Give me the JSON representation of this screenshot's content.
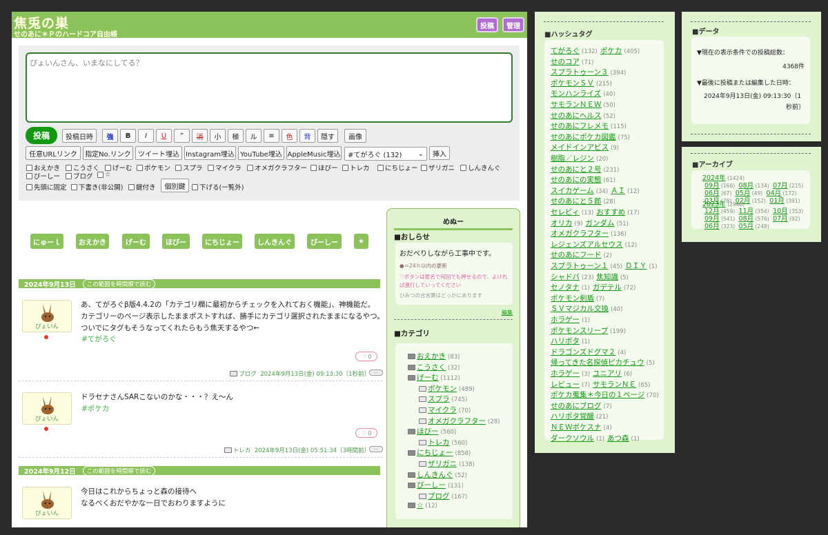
{
  "header": {
    "title": "焦兎の巣",
    "subtitle": "せのあに＊Ｐのハードコア自由帳",
    "post_btn": "投稿",
    "admin_btn": "管理"
  },
  "form": {
    "placeholder": "ぴょいんさん、いまなにしてる？",
    "post_label": "投稿",
    "row1": [
      "投稿日時",
      "強",
      "B",
      "I",
      "U",
      "”",
      "消",
      "小",
      "極",
      "ル",
      "≡",
      "色",
      "背",
      "隠す",
      "画像"
    ],
    "row2": [
      "任意URLリンク",
      "指定No.リンク",
      "ツイート埋込",
      "Instagram埋込",
      "YouTube埋込",
      "AppleMusic埋込"
    ],
    "tag_select": "#てがろぐ (132)",
    "insert_label": "挿入",
    "categories": [
      "おえかき",
      "こうさく",
      "げーむ",
      "ポケモン",
      "スプラ",
      "マイクラ",
      "オメガクラフター",
      "ほびー",
      "トレカ",
      "にちじょー",
      "ザリガニ",
      "しんきんぐ",
      "びーしー",
      "ブログ",
      "☆"
    ],
    "options": [
      "先頭に固定",
      "下書き(非公開)",
      "鍵付き",
      "個別鍵",
      "下げる(一覧外)"
    ]
  },
  "category_buttons": [
    "にゅーｌ",
    "おえかき",
    "げーむ",
    "ほびー",
    "にちじょー",
    "しんきんぐ",
    "びーしー",
    "★"
  ],
  "posts": [
    {
      "date_bar": "2024年9月13日",
      "date_link": "この範囲を時間順で読む",
      "author": "ぴょいん",
      "lines": [
        "あ、てがろぐβ版4.4.2の「カテゴリ欄に最初からチェックを入れておく機能」、神機能だ。",
        "カテゴリーのページ表示したままポストすれば、勝手にカテゴリ選択されたままになるやつ。",
        "ついでにタグもそうなってくれたらもう焦天するやつ←"
      ],
      "tag": "#てがろぐ",
      "likes": "0",
      "category": "ブログ",
      "timestamp": "2024年9月13日(金) 09:13:30〔1秒前〕"
    },
    {
      "author": "ぴょいん",
      "lines": [
        "ドラセナさんSARこないのかな・・・？え～ん"
      ],
      "tag": "#ポケカ",
      "likes": "0",
      "category": "トレカ",
      "timestamp": "2024年9月13日(金) 05:51:34〔3時間前〕"
    },
    {
      "date_bar": "2024年9月12日",
      "date_link": "この範囲を時間順で読む",
      "author": "ぴょいん",
      "lines": [
        "今日はこれからちょっと森の接待へ",
        "なるべくおだやかな一日でおわりますように"
      ]
    }
  ],
  "menu": {
    "title": "めぬー",
    "notice_title": "■おしらせ",
    "notice_text": "おだべりしながら工事中です。",
    "notice_note1": "●＝24ｈ以内の更新",
    "notice_note2": "♡ボタンは匿名で何回でも押せるので、よければ連打していってください",
    "notice_note3": "ひみつの合言葉はどっかにあります",
    "edit_link": "編集",
    "cat_title": "■カテゴリ",
    "cats": [
      {
        "name": "おえかき",
        "count": "(83)"
      },
      {
        "name": "こうさく",
        "count": "(32)"
      },
      {
        "name": "げーむ",
        "count": "(1112)"
      },
      {
        "name": "ポケモン",
        "count": "(489)"
      },
      {
        "name": "スプラ",
        "count": "(745)"
      },
      {
        "name": "マイクラ",
        "count": "(70)"
      },
      {
        "name": "オメガクラフター",
        "count": "(28)"
      },
      {
        "name": "ほびー",
        "count": "(560)"
      },
      {
        "name": "トレカ",
        "count": "(560)"
      },
      {
        "name": "にちじょー",
        "count": "(858)"
      },
      {
        "name": "ザリガニ",
        "count": "(138)"
      },
      {
        "name": "しんきんぐ",
        "count": "(52)"
      },
      {
        "name": "びーしー",
        "count": "(131)"
      },
      {
        "name": "ブログ",
        "count": "(167)"
      },
      {
        "name": "☆",
        "count": "(12)"
      }
    ]
  },
  "hashtags": {
    "title": "■ハッシュタグ",
    "rows": [
      [
        {
          "t": "てがろぐ",
          "c": "(132)"
        },
        {
          "t": "ポケカ",
          "c": "(405)"
        }
      ],
      [
        {
          "t": "せのコア",
          "c": "(71)"
        }
      ],
      [
        {
          "t": "スプラトゥーン３",
          "c": "(394)"
        }
      ],
      [
        {
          "t": "ポケモンＳＶ",
          "c": "(215)"
        }
      ],
      [
        {
          "t": "モンハンライズ",
          "c": "(40)"
        }
      ],
      [
        {
          "t": "サモランＮＥＷ",
          "c": "(50)"
        }
      ],
      [
        {
          "t": "せのあにヘルス",
          "c": "(52)"
        }
      ],
      [
        {
          "t": "せのあにフレメモ",
          "c": "(115)"
        }
      ],
      [
        {
          "t": "せのあにポケカ図鑑",
          "c": "(75)"
        }
      ],
      [
        {
          "t": "メイドインアビス",
          "c": "(9)"
        }
      ],
      [
        {
          "t": "樹脂／レジン",
          "c": "(20)"
        }
      ],
      [
        {
          "t": "せのあにと２号",
          "c": "(231)"
        }
      ],
      [
        {
          "t": "せのあにの実態",
          "c": "(61)"
        }
      ],
      [
        {
          "t": "スイカゲーム",
          "c": "(34)"
        },
        {
          "t": "ＡＩ",
          "c": "(12)"
        }
      ],
      [
        {
          "t": "せのあにと５郎",
          "c": "(28)"
        }
      ],
      [
        {
          "t": "セレビィ",
          "c": "(13)"
        },
        {
          "t": "おすすめ",
          "c": "(17)"
        }
      ],
      [
        {
          "t": "オリカ",
          "c": "(9)"
        },
        {
          "t": "ガンダム",
          "c": "(51)"
        }
      ],
      [
        {
          "t": "オメガクラフター",
          "c": "(136)"
        }
      ],
      [
        {
          "t": "レジェンズアルセウス",
          "c": "(12)"
        }
      ],
      [
        {
          "t": "せのあにフード",
          "c": "(2)"
        }
      ],
      [
        {
          "t": "スプラトゥーン１",
          "c": "(45)"
        },
        {
          "t": "ＤＩＹ",
          "c": "(1)"
        }
      ],
      [
        {
          "t": "シャドバ",
          "c": "(23)"
        },
        {
          "t": "焦知識",
          "c": "(5)"
        }
      ],
      [
        {
          "t": "セノタナ",
          "c": "(1)"
        },
        {
          "t": "ガデテル",
          "c": "(72)"
        }
      ],
      [
        {
          "t": "ポケモン剣盾",
          "c": "(7)"
        }
      ],
      [
        {
          "t": "ＳＶマジカル交換",
          "c": "(40)"
        }
      ],
      [
        {
          "t": "ホラゲー",
          "c": "(1)"
        }
      ],
      [
        {
          "t": "ポケモンスリープ",
          "c": "(199)"
        }
      ],
      [
        {
          "t": "ハリポタ",
          "c": "(1)"
        }
      ],
      [
        {
          "t": "ドラゴンズドグマ２",
          "c": "(4)"
        }
      ],
      [
        {
          "t": "帰ってきた名探偵ピカチュウ",
          "c": "(5)"
        }
      ],
      [
        {
          "t": "ホラゲー",
          "c": "(3)"
        },
        {
          "t": "ユニアリ",
          "c": "(6)"
        }
      ],
      [
        {
          "t": "レビュー",
          "c": "(7)"
        },
        {
          "t": "サモランＮＥ",
          "c": "(65)"
        }
      ],
      [
        {
          "t": "ポケカ蒐集＊今日の１ページ",
          "c": "(70)"
        }
      ],
      [
        {
          "t": "せのあにブログ",
          "c": "(7)"
        }
      ],
      [
        {
          "t": "ハリポタ覚醒",
          "c": "(21)"
        }
      ],
      [
        {
          "t": "ＮＥＷポケスナ",
          "c": "(4)"
        }
      ],
      [
        {
          "t": "ダークソウル",
          "c": "(1)"
        },
        {
          "t": "あつ森",
          "c": "(1)"
        }
      ]
    ]
  },
  "data_panel": {
    "title": "■データ",
    "label1": "▼現在の表示条件での投稿総数：",
    "value1": "4368件",
    "label2": "▼最後に投稿または編集した日時：",
    "value2a": "2024年9月13日(金) 09:13:30〔1",
    "value2b": "秒前〕"
  },
  "archive": {
    "title": "■アーカイブ",
    "year2024": "2024年",
    "count2024": "(1424)",
    "rows2024": [
      [
        {
          "m": "09月",
          "c": "(166)"
        },
        {
          "m": "08月",
          "c": "(134)"
        },
        {
          "m": "07月",
          "c": "(215)"
        }
      ],
      [
        {
          "m": "06月",
          "c": "(67)"
        },
        {
          "m": "05月",
          "c": "(49)"
        },
        {
          "m": "04月",
          "c": "(172)"
        }
      ],
      [
        {
          "m": "03月",
          "c": "(78)"
        },
        {
          "m": "02月",
          "c": "(152)"
        },
        {
          "m": "01月",
          "c": "(391)"
        }
      ]
    ],
    "year2023": "2023年",
    "count2023": "(2946)",
    "rows2023": [
      [
        {
          "m": "12月",
          "c": "(459)"
        },
        {
          "m": "11月",
          "c": "(354)"
        },
        {
          "m": "10月",
          "c": "(353)"
        }
      ],
      [
        {
          "m": "09月",
          "c": "(541)"
        },
        {
          "m": "08月",
          "c": "(576)"
        },
        {
          "m": "07月",
          "c": "(92)"
        }
      ],
      [
        {
          "m": "06月",
          "c": "(323)"
        },
        {
          "m": "05月",
          "c": "(248)"
        }
      ]
    ]
  }
}
